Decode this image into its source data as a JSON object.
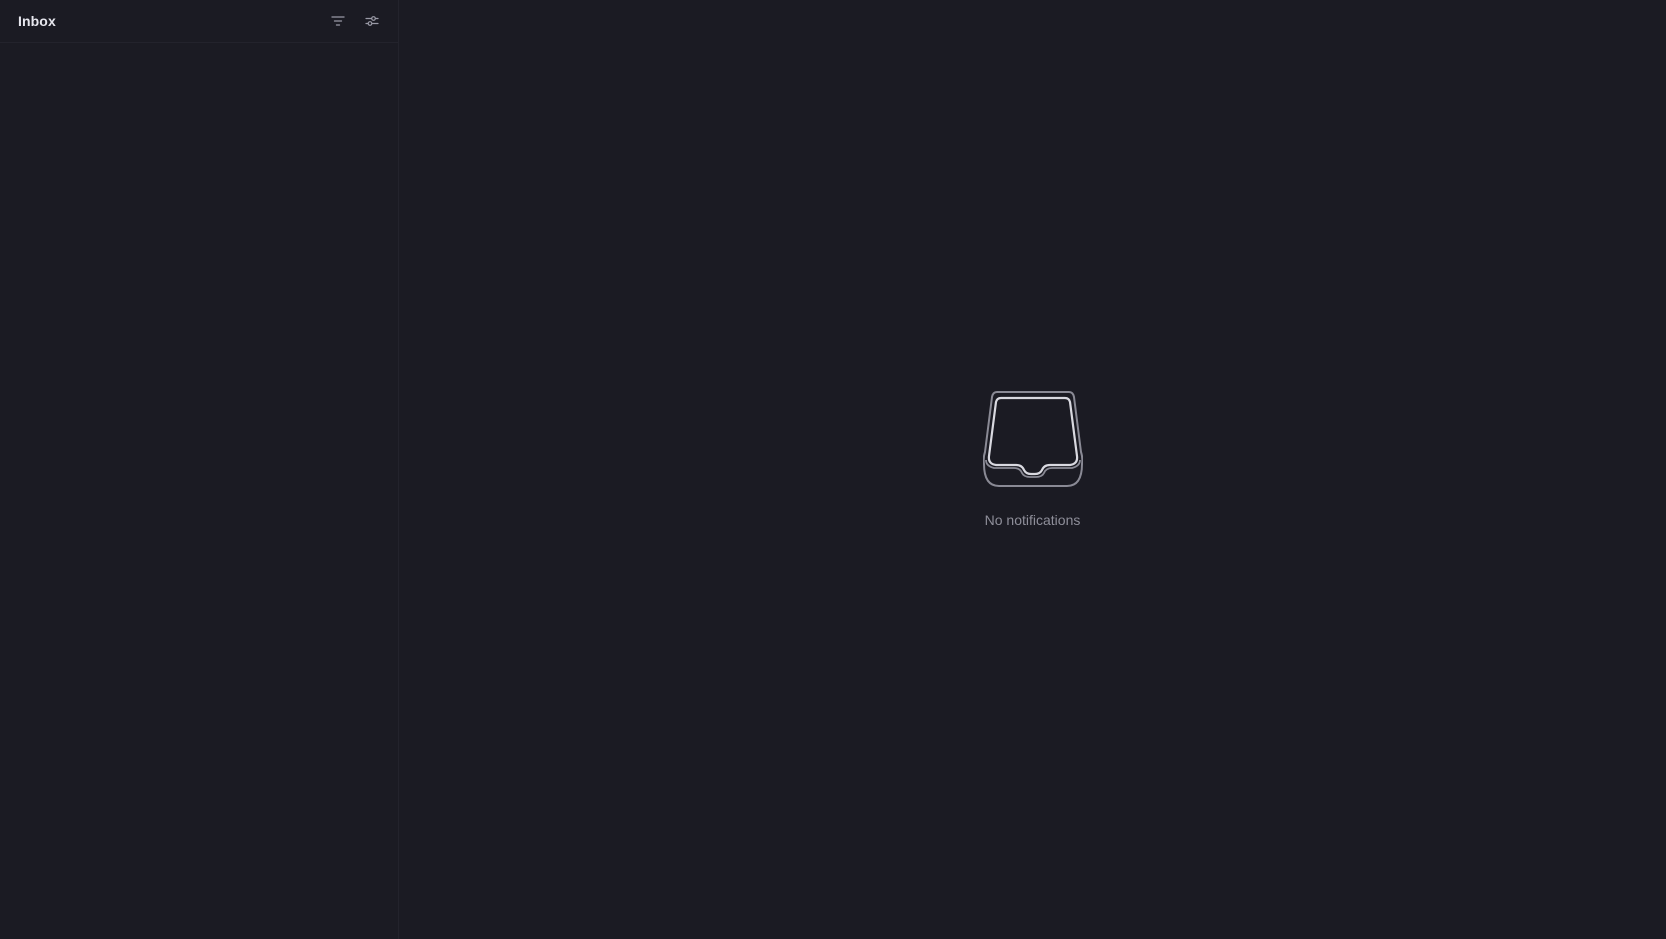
{
  "sidebar": {
    "title": "Inbox",
    "actions": [
      {
        "icon": "filter-icon",
        "label": "Filter"
      },
      {
        "icon": "sliders-icon",
        "label": "Display settings"
      }
    ]
  },
  "main": {
    "empty_state": {
      "icon": "inbox-tray-icon",
      "text": "No notifications"
    }
  },
  "colors": {
    "background": "#1b1b23",
    "border": "#23232c",
    "title_text": "#e7e7ee",
    "muted_text": "#8e8e99",
    "icon": "#9a9aa6"
  }
}
